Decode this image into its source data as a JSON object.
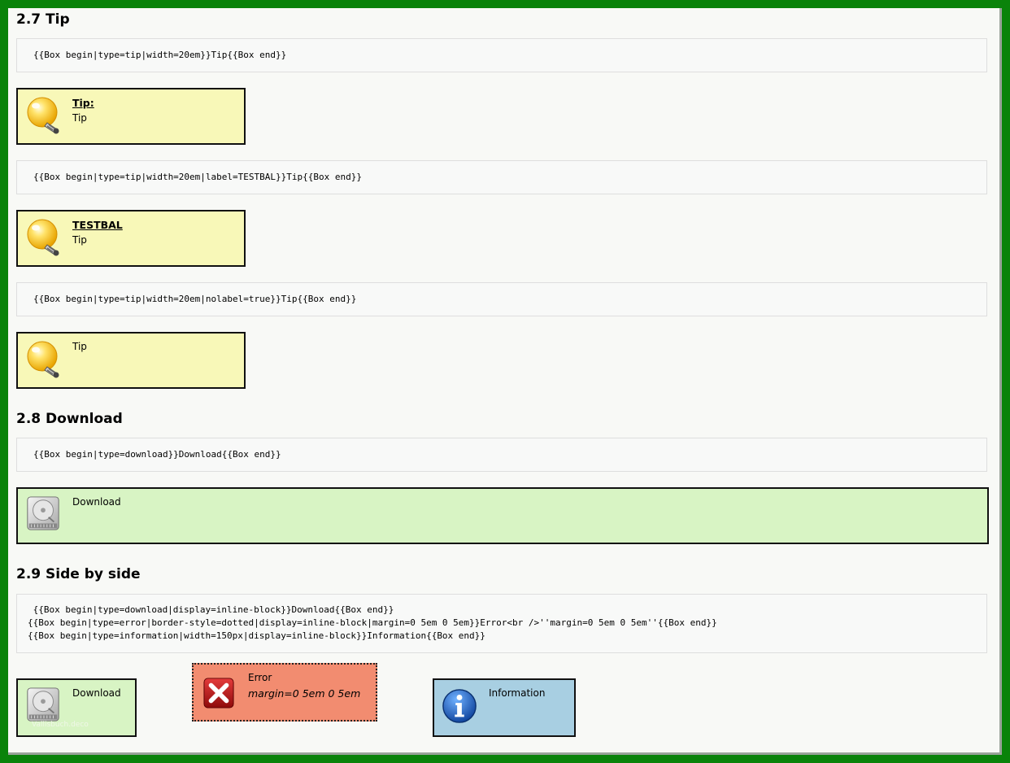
{
  "sections": {
    "tip": {
      "heading": "2.7 Tip",
      "code1": "{{Box begin|type=tip|width=20em}}Tip{{Box end}}",
      "box1_label": "Tip:",
      "box1_text": "Tip",
      "code2": "{{Box begin|type=tip|width=20em|label=TESTBAL}}Tip{{Box end}}",
      "box2_label": "TESTBAL",
      "box2_text": "Tip",
      "code3": "{{Box begin|type=tip|width=20em|nolabel=true}}Tip{{Box end}}",
      "box3_text": "Tip"
    },
    "download": {
      "heading": "2.8 Download",
      "code": "{{Box begin|type=download}}Download{{Box end}}",
      "box_text": "Download"
    },
    "side": {
      "heading": "2.9 Side by side",
      "code": " {{Box begin|type=download|display=inline-block}}Download{{Box end}}\n{{Box begin|type=error|border-style=dotted|display=inline-block|margin=0 5em 0 5em}}Error<br />''margin=0 5em 0 5em''{{Box end}}\n{{Box begin|type=information|width=150px|display=inline-block}}Information{{Box end}}",
      "download_text": "Download",
      "download_watermark": "Vallisbuch.deco",
      "error_text": "Error",
      "error_text2": "margin=0 5em 0 5em",
      "info_text": "Information"
    }
  },
  "icons": {
    "tip": "lightbulb-icon",
    "download": "hard-drive-icon",
    "error": "error-x-icon",
    "information": "information-icon"
  },
  "colors": {
    "frame": "#0a830a",
    "tip_bg": "#f8f8b8",
    "download_bg": "#d8f4c4",
    "error_bg": "#f28c70",
    "info_bg": "#a8cfe2"
  }
}
